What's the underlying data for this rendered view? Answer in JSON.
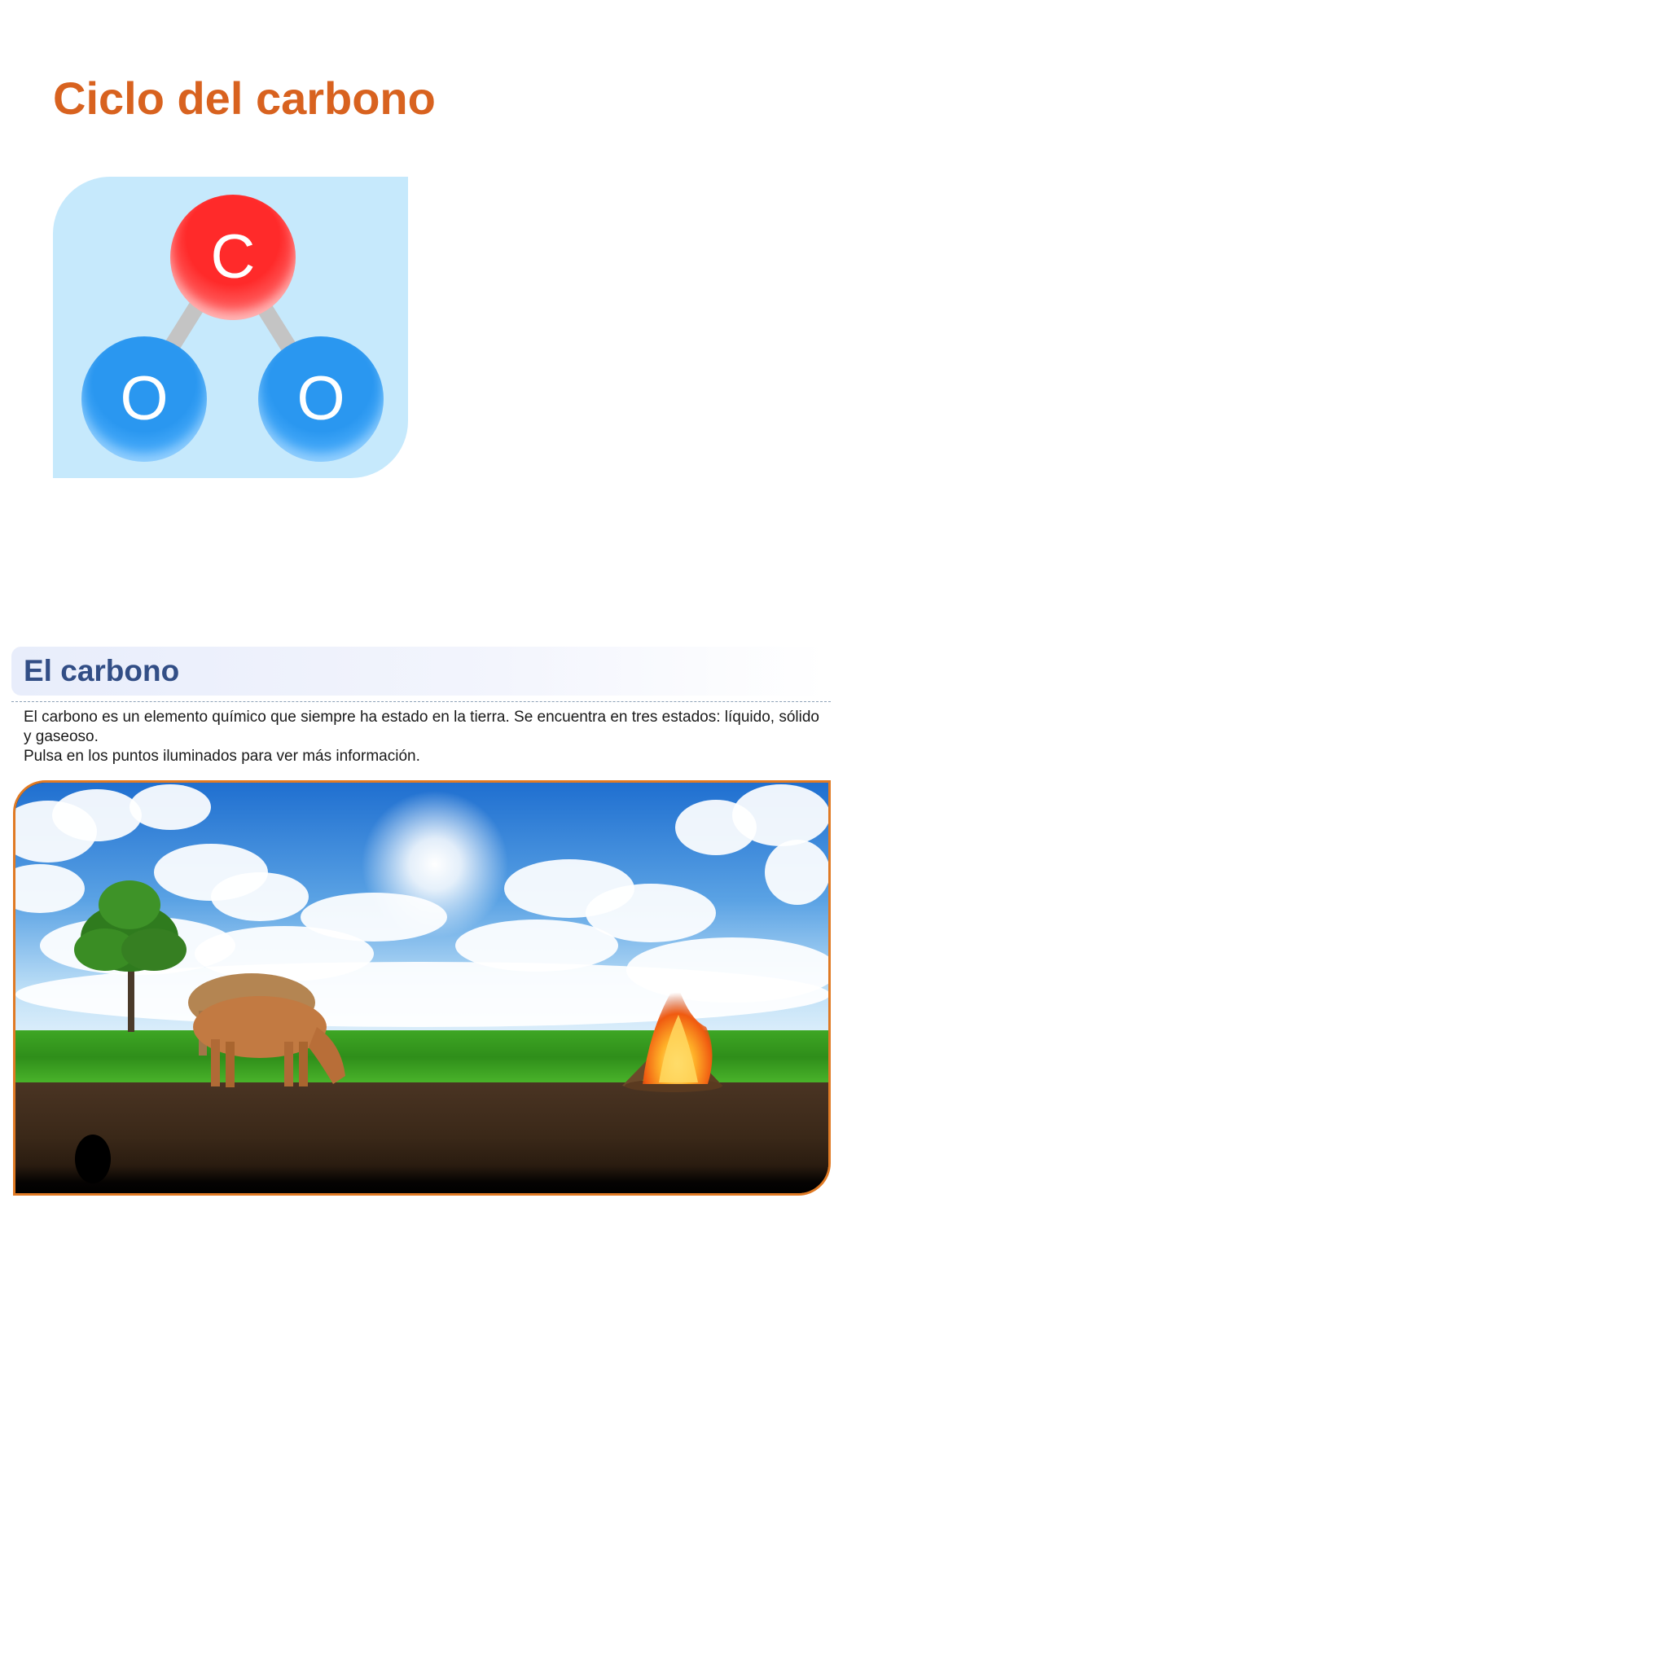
{
  "page": {
    "title": "Ciclo del carbono"
  },
  "molecule": {
    "atoms": [
      {
        "symbol": "C"
      },
      {
        "symbol": "O"
      },
      {
        "symbol": "O"
      }
    ]
  },
  "section": {
    "title": "El carbono",
    "paragraph_1": "El carbono es un elemento químico que siempre ha estado en la tierra. Se encuentra en tres estados: líquido, sólido y gaseoso.",
    "paragraph_2": "Pulsa en los puntos iluminados para ver más información."
  },
  "scene": {
    "elements": [
      "sky",
      "sun",
      "clouds",
      "tree",
      "cows",
      "bonfire",
      "grass",
      "soil"
    ]
  },
  "colors": {
    "title": "#d8621f",
    "section_title": "#324e86",
    "scene_border": "#e07a24",
    "molecule_bg": "#c6e9fc",
    "carbon_atom": "#ff2a2a",
    "oxygen_atom": "#2a97f0"
  }
}
